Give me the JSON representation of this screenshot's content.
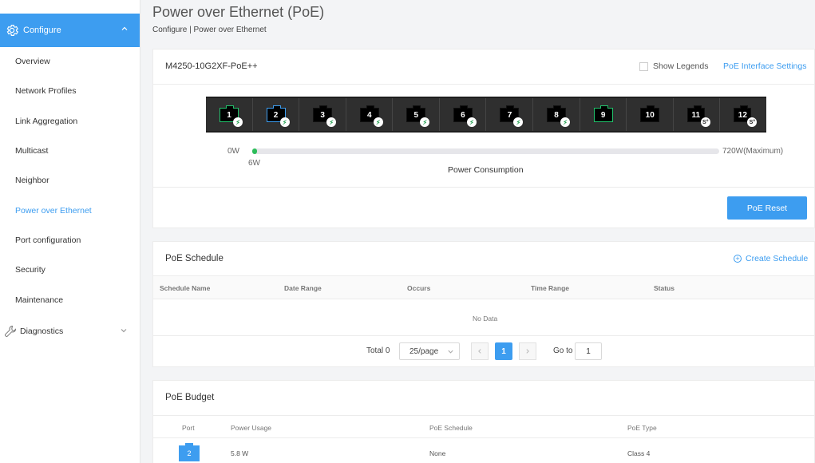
{
  "sidebar": {
    "configure_label": "Configure",
    "items": [
      "Overview",
      "Network Profiles",
      "Link Aggregation",
      "Multicast",
      "Neighbor",
      "Power over Ethernet",
      "Port configuration",
      "Security",
      "Maintenance"
    ],
    "active_item": "Power over Ethernet",
    "diagnostics_label": "Diagnostics"
  },
  "header": {
    "title": "Power over Ethernet (PoE)",
    "breadcrumb": "Configure | Power over Ethernet"
  },
  "device": {
    "name": "M4250-10G2XF-PoE++",
    "show_legends": "Show Legends",
    "poe_settings_link": "PoE Interface Settings",
    "ports": [
      {
        "label": "1",
        "status": "green",
        "poe": true
      },
      {
        "label": "2",
        "status": "blue",
        "poe": true
      },
      {
        "label": "3",
        "status": "none",
        "poe": true
      },
      {
        "label": "4",
        "status": "none",
        "poe": true
      },
      {
        "label": "5",
        "status": "none",
        "poe": true
      },
      {
        "label": "6",
        "status": "none",
        "poe": true
      },
      {
        "label": "7",
        "status": "none",
        "poe": true
      },
      {
        "label": "8",
        "status": "none",
        "poe": true
      },
      {
        "label": "9",
        "status": "green",
        "poe": false
      },
      {
        "label": "10",
        "status": "none",
        "poe": false
      },
      {
        "label": "11",
        "status": "none",
        "sfp": true
      },
      {
        "label": "12",
        "status": "none",
        "sfp": true
      }
    ],
    "colors": {
      "green": "#21c16b",
      "blue": "#3d9df0"
    }
  },
  "power": {
    "min_label": "0W",
    "max_label": "720W(Maximum)",
    "used_label": "6W",
    "used_watts": 6,
    "max_watts": 720,
    "caption": "Power Consumption",
    "reset_button": "PoE Reset"
  },
  "schedule": {
    "title": "PoE Schedule",
    "create_link": "Create Schedule",
    "columns": [
      "Schedule Name",
      "Date Range",
      "Occurs",
      "Time Range",
      "Status"
    ],
    "empty_text": "No Data",
    "total": "Total 0",
    "page_size": "25/page",
    "current_page": "1",
    "goto_label": "Go to",
    "goto_value": "1"
  },
  "budget": {
    "title": "PoE Budget",
    "columns": [
      "Port",
      "Power Usage",
      "PoE Schedule",
      "PoE Type"
    ],
    "rows": [
      {
        "port": "2",
        "power_usage": "5.8 W",
        "schedule": "None",
        "type": "Class 4"
      }
    ]
  }
}
